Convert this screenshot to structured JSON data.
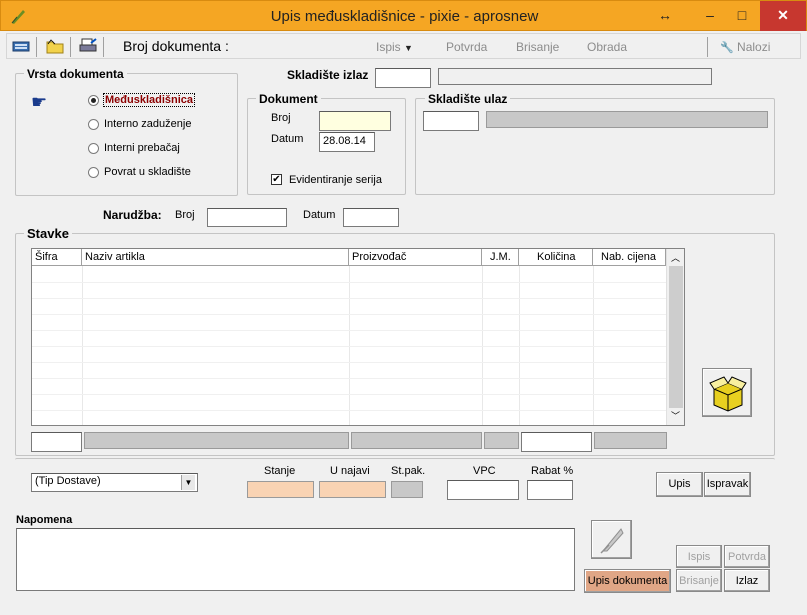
{
  "window": {
    "title": "Upis međuskladišnice - pixie - aprosnew",
    "resize_glyph": "↔",
    "min_glyph": "–",
    "max_glyph": "□",
    "close_glyph": "✕"
  },
  "toolbar": {
    "doc_label": "Broj dokumenta :",
    "ispis": "Ispis",
    "potvrda": "Potvrda",
    "brisanje": "Brisanje",
    "obrada": "Obrada",
    "nalozi": "Nalozi"
  },
  "vrsta": {
    "legend": "Vrsta dokumenta",
    "options": [
      "Međuskladišnica",
      "Interno zaduženje",
      "Interni prebačaj",
      "Povrat u skladište"
    ],
    "selected": 0
  },
  "skladiste_izlaz": {
    "label": "Skladište izlaz",
    "code": "",
    "name": ""
  },
  "dokument": {
    "legend": "Dokument",
    "broj_label": "Broj",
    "broj_value": "",
    "datum_label": "Datum",
    "datum_value": "28.08.14",
    "serije_label": "Evidentiranje serija",
    "serije_checked": true
  },
  "skladiste_ulaz": {
    "legend": "Skladište ulaz",
    "code": "",
    "name": ""
  },
  "narudzba": {
    "label": "Narudžba:",
    "broj_label": "Broj",
    "broj_value": "",
    "datum_label": "Datum",
    "datum_value": ""
  },
  "stavke": {
    "legend": "Stavke",
    "columns": [
      "Šifra",
      "Naziv artikla",
      "Proizvođač",
      "J.M.",
      "Količina",
      "Nab. cijena"
    ]
  },
  "bottom": {
    "tip_dostave": "(Tip Dostave)",
    "stanje": "Stanje",
    "u_najavi": "U najavi",
    "st_pak": "St.pak.",
    "vpc": "VPC",
    "rabat": "Rabat %",
    "upis": "Upis",
    "ispravak": "Ispravak"
  },
  "napomena": {
    "label": "Napomena",
    "value": ""
  },
  "actions": {
    "upis_dokumenta": "Upis dokumenta",
    "ispis": "Ispis",
    "potvrda": "Potvrda",
    "brisanje": "Brisanje",
    "izlaz": "Izlaz"
  },
  "colors": {
    "title_bar": "#f5a623",
    "close": "#c7372f",
    "selected_option": "#8b0000",
    "highlight_input": "#ffffe0",
    "peach": "#f9d3b3",
    "upis_dokumenta": "#e0a686"
  }
}
